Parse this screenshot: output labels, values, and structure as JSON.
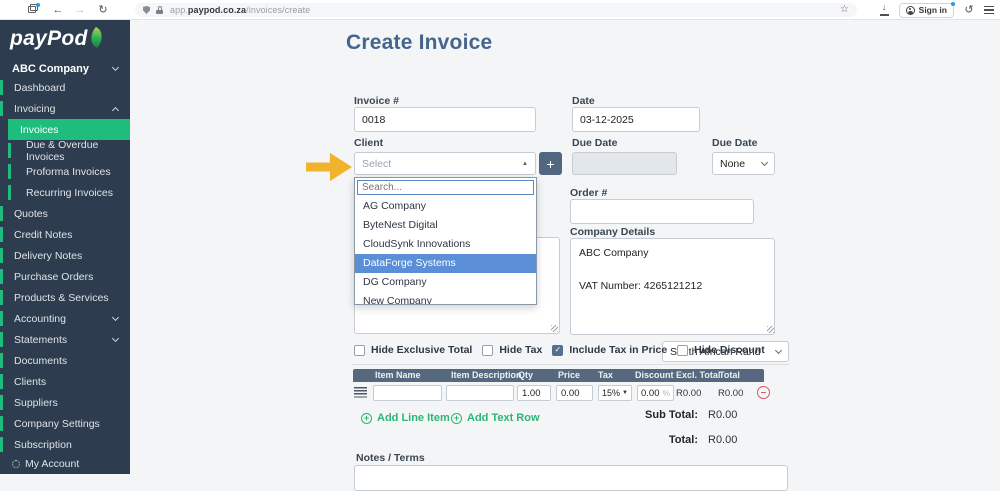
{
  "icons": {
    "back": "←",
    "forward": "→",
    "reload": "↻",
    "restore": "↺",
    "star": "☆",
    "caret_up": "▲",
    "caret_down_small": "▼",
    "plus": "+",
    "check": "✓",
    "download_arrow": "↓"
  },
  "browser": {
    "url_prefix": "app.",
    "url_domain": "paypod.co.za",
    "url_path": "/invoices/create",
    "sign_in_label": "Sign in"
  },
  "sidebar": {
    "logo_text": "payPod",
    "company_selector": "ABC Company",
    "items": [
      {
        "label": "Dashboard"
      },
      {
        "label": "Invoicing"
      },
      {
        "label": "Invoices"
      },
      {
        "label": "Due & Overdue Invoices"
      },
      {
        "label": "Proforma Invoices"
      },
      {
        "label": "Recurring Invoices"
      },
      {
        "label": "Quotes"
      },
      {
        "label": "Credit Notes"
      },
      {
        "label": "Delivery Notes"
      },
      {
        "label": "Purchase Orders"
      },
      {
        "label": "Products & Services"
      },
      {
        "label": "Accounting"
      },
      {
        "label": "Statements"
      },
      {
        "label": "Documents"
      },
      {
        "label": "Clients"
      },
      {
        "label": "Suppliers"
      },
      {
        "label": "Company Settings"
      },
      {
        "label": "Subscription"
      }
    ],
    "my_account_label": "My Account",
    "colors": {
      "background": "#2d3c4e",
      "active_green": "#1fbd7d"
    }
  },
  "page": {
    "title": "Create Invoice"
  },
  "form": {
    "invoice_number": {
      "label": "Invoice #",
      "value": "0018"
    },
    "date": {
      "label": "Date",
      "value": "03-12-2025"
    },
    "client": {
      "label": "Client",
      "placeholder": "Select"
    },
    "due_date": {
      "label": "Due Date",
      "value": ""
    },
    "due_date_preset": {
      "label": "Due Date",
      "value": "None"
    },
    "order_number": {
      "label": "Order #",
      "value": ""
    },
    "company_details": {
      "label": "Company Details",
      "value": "ABC Company\n\nVAT Number: 4265121212"
    },
    "client_details": {
      "value": ""
    },
    "client_dropdown": {
      "search_placeholder": "Search...",
      "options": [
        {
          "label": "AG Company"
        },
        {
          "label": "ByteNest Digital"
        },
        {
          "label": "CloudSynk Innovations"
        },
        {
          "label": "DataForge Systems",
          "highlighted": true
        },
        {
          "label": "DG Company"
        },
        {
          "label": "New Company"
        }
      ]
    },
    "options_row": {
      "hide_exclusive_total": {
        "label": "Hide Exclusive Total",
        "checked": false
      },
      "hide_tax": {
        "label": "Hide Tax",
        "checked": false
      },
      "include_tax_in_price": {
        "label": "Include Tax in Price",
        "checked": true
      },
      "hide_discount": {
        "label": "Hide Discount",
        "checked": false
      }
    },
    "currency": {
      "value": "South African Rand"
    }
  },
  "items_table": {
    "headers": [
      "Item Name",
      "Item Description",
      "Qty",
      "Price",
      "Tax",
      "Discount",
      "Excl. Total",
      "Total"
    ],
    "row": {
      "item_name": "",
      "item_description": "",
      "qty": "1.00",
      "price": "0.00",
      "tax": "15%",
      "discount": "0.00",
      "discount_unit": "%",
      "excl_total": "R0.00",
      "total": "R0.00"
    }
  },
  "actions": {
    "add_line_item": "Add Line Item",
    "add_text_row": "Add Text Row"
  },
  "totals": {
    "sub_total_label": "Sub Total:",
    "sub_total_value": "R0.00",
    "total_label": "Total:",
    "total_value": "R0.00"
  },
  "notes": {
    "label": "Notes / Terms",
    "value": ""
  }
}
